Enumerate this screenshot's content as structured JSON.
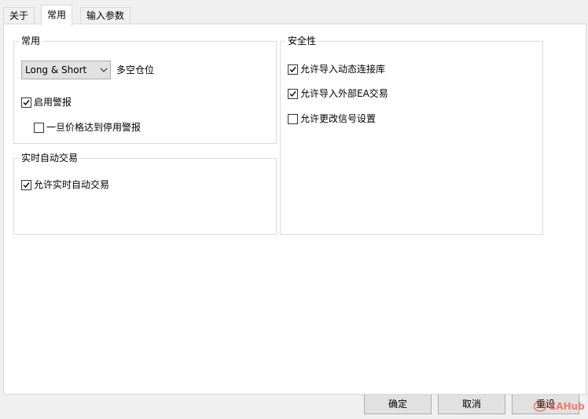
{
  "tabs": [
    "关于",
    "常用",
    "输入参数"
  ],
  "common_group": {
    "title": "常用",
    "position_select": {
      "value": "Long & Short",
      "label": "多空仓位"
    },
    "enable_alerts": {
      "label": "启用警报",
      "checked": true
    },
    "disable_alerts_on_stop": {
      "label": "一旦价格达到停用警报",
      "checked": false
    }
  },
  "live_trading_group": {
    "title": "实时自动交易",
    "allow_live_trading": {
      "label": "允许实时自动交易",
      "checked": true
    }
  },
  "security_group": {
    "title": "安全性",
    "allow_dll_import": {
      "label": "允许导入动态连接库",
      "checked": true
    },
    "allow_external_ea_import": {
      "label": "允许导入外部EA交易",
      "checked": true
    },
    "allow_signal_settings_change": {
      "label": "允许更改信号设置",
      "checked": false
    }
  },
  "buttons": {
    "ok": "确定",
    "cancel": "取消",
    "reset": "重设"
  },
  "watermark": {
    "text": "EAHub"
  }
}
